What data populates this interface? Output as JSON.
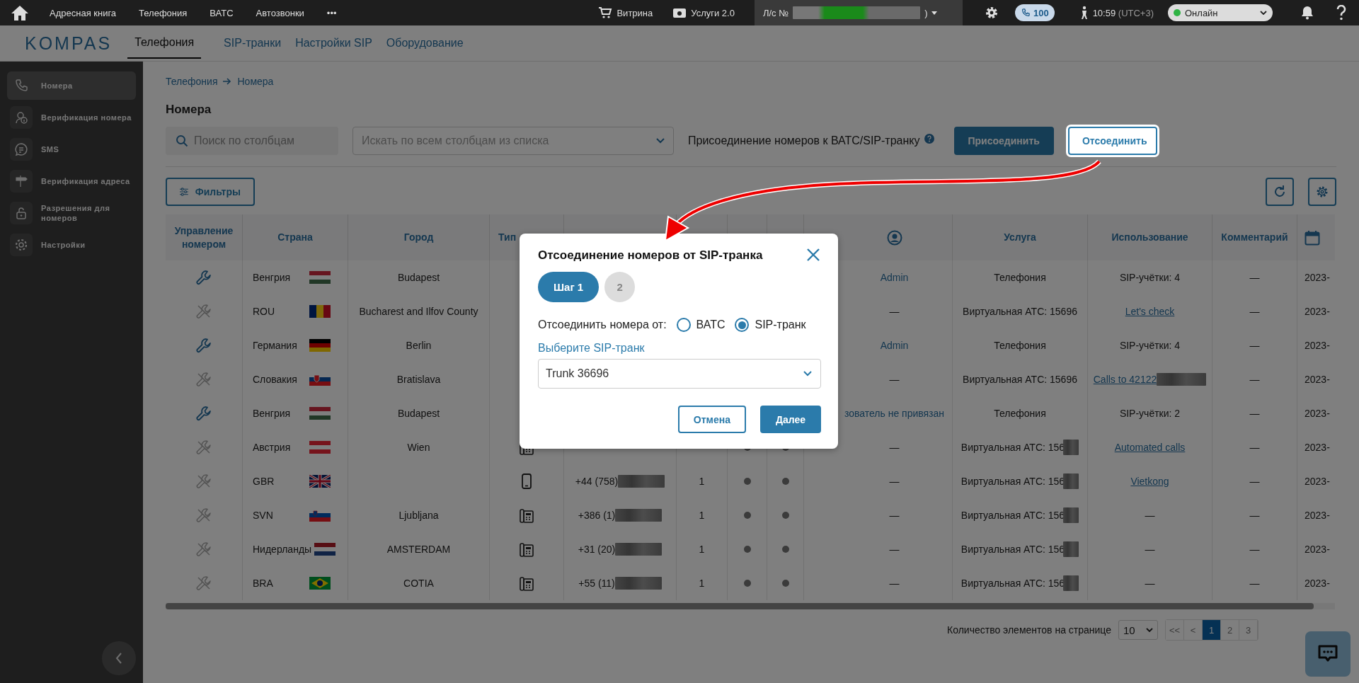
{
  "topbar": {
    "nav": [
      "Адресная книга",
      "Телефония",
      "ВАТС",
      "Автозвонки",
      "•••"
    ],
    "showcase": "Витрина",
    "services": "Услуги 2.0",
    "account_prefix": "Л/с №",
    "account_suffix": ")",
    "calls_badge": "100",
    "time": "10:59",
    "timezone": "(UTC+3)",
    "status": {
      "label": "Онлайн",
      "color": "#2fb344"
    }
  },
  "subnav": {
    "logo": "KOMPAS",
    "tabs": [
      {
        "label": "Телефония",
        "selected": true
      },
      {
        "label": "SIP-транки",
        "selected": false
      },
      {
        "label": "Настройки SIP",
        "selected": false
      },
      {
        "label": "Оборудование",
        "selected": false
      }
    ]
  },
  "sidebar": {
    "items": [
      {
        "label": "Номера",
        "kind": "phone",
        "selected": true
      },
      {
        "label": "Верификация номера",
        "kind": "verify",
        "selected": false
      },
      {
        "label": "SMS",
        "kind": "sms",
        "selected": false
      },
      {
        "label": "Верификация адреса",
        "kind": "sign",
        "selected": false
      },
      {
        "label": "Разрешения для номеров",
        "kind": "lock",
        "selected": false
      },
      {
        "label": "Настройки",
        "kind": "gear",
        "selected": false
      }
    ]
  },
  "breadcrumb": [
    "Телефония",
    "Номера"
  ],
  "title": "Номера",
  "toolbar": {
    "search_placeholder": "Поиск по столбцам",
    "columns_placeholder": "Искать по всем столбцам из списка",
    "attach_label": "Присоединение номеров к ВАТС/SIP-транку",
    "attach_button": "Присоединить",
    "detach_button": "Отсоединить",
    "filters_button": "Фильтры"
  },
  "table": {
    "headers": {
      "manage": "Управление номером",
      "country": "Страна",
      "city": "Город",
      "type": "Тип",
      "service": "Услуга",
      "usage": "Использование",
      "comment": "Комментарий"
    },
    "rows": [
      {
        "manage_enabled": true,
        "country": "Венгрия",
        "flag": {
          "kind": "hu"
        },
        "city": "Budapest",
        "user": "Admin",
        "user_link": true,
        "service": "Телефония",
        "usage": "SIP-учётки: 4",
        "usage_link": false,
        "comment": "—",
        "date": "2023-"
      },
      {
        "manage_enabled": false,
        "country": "ROU",
        "flag": {
          "kind": "ro"
        },
        "city": "Bucharest and Ilfov County",
        "user": "—",
        "user_link": false,
        "service": "Виртуальная АТС: 15696",
        "usage": "Let's check",
        "usage_link": true,
        "comment": "—",
        "date": "2023-"
      },
      {
        "manage_enabled": true,
        "country": "Германия",
        "flag": {
          "kind": "de"
        },
        "city": "Berlin",
        "user": "Admin",
        "user_link": true,
        "service": "Телефония",
        "usage": "SIP-учётки: 4",
        "usage_link": false,
        "comment": "—",
        "date": "2023-"
      },
      {
        "manage_enabled": false,
        "country": "Словакия",
        "flag": {
          "kind": "sk"
        },
        "city": "Bratislava",
        "user": "—",
        "user_link": false,
        "service": "Виртуальная АТС: 15696",
        "usage": "Calls to 42122",
        "usage_link": true,
        "usage_redacted": true,
        "comment": "—",
        "date": "2023-"
      },
      {
        "manage_enabled": true,
        "country": "Венгрия",
        "flag": {
          "kind": "hu"
        },
        "city": "Budapest",
        "user": "зователь не привязан",
        "user_link": true,
        "service": "Телефония",
        "usage": "SIP-учётки: 2",
        "usage_link": false,
        "comment": "—",
        "date": "2023-"
      },
      {
        "manage_enabled": false,
        "country": "Австрия",
        "flag": {
          "kind": "at"
        },
        "city": "Wien",
        "phone": {
          "kind": "desk"
        },
        "status_dots": true,
        "user": "—",
        "user_link": false,
        "service": "Виртуальная АТС: 156",
        "service_redacted": true,
        "usage": "Automated calls",
        "usage_link": true,
        "comment": "—",
        "date": "2023-"
      },
      {
        "manage_enabled": false,
        "country": "GBR",
        "flag": {
          "kind": "gb"
        },
        "phone": {
          "kind": "mobile",
          "number": "+44 (758)"
        },
        "count": "1",
        "status_dots": true,
        "user": "—",
        "user_link": false,
        "service": "Виртуальная АТС: 156",
        "service_redacted": true,
        "usage": "Vietkong",
        "usage_link": true,
        "comment": "—",
        "date": "2023-"
      },
      {
        "manage_enabled": false,
        "country": "SVN",
        "flag": {
          "kind": "si"
        },
        "city": "Ljubljana",
        "phone": {
          "kind": "desk",
          "number": "+386 (1)"
        },
        "count": "1",
        "status_dots": true,
        "user": "—",
        "user_link": false,
        "service": "Виртуальная АТС: 156",
        "service_redacted": true,
        "usage": "—",
        "usage_link": false,
        "comment": "—",
        "date": "2023-"
      },
      {
        "manage_enabled": false,
        "country": "Нидерланды",
        "flag": {
          "kind": "nl"
        },
        "city": "AMSTERDAM",
        "phone": {
          "kind": "desk",
          "number": "+31 (20)"
        },
        "count": "1",
        "status_dots": true,
        "user": "—",
        "user_link": false,
        "service": "Виртуальная АТС: 156",
        "service_redacted": true,
        "usage": "—",
        "usage_link": false,
        "comment": "—",
        "date": "2023-"
      },
      {
        "manage_enabled": false,
        "country": "BRA",
        "flag": {
          "kind": "br"
        },
        "city": "COTIA",
        "phone": {
          "kind": "desk",
          "number": "+55 (11)"
        },
        "count": "1",
        "status_dots": true,
        "user": "—",
        "user_link": false,
        "service": "Виртуальная АТС: 156",
        "service_redacted": true,
        "usage": "—",
        "usage_link": false,
        "comment": "—",
        "date": "2023-"
      }
    ]
  },
  "pagination": {
    "per_page_label": "Количество элементов на странице",
    "per_page": "10",
    "pages": [
      {
        "label": "<<",
        "selected": false
      },
      {
        "label": "<",
        "selected": false
      },
      {
        "label": "1",
        "selected": true
      },
      {
        "label": "2",
        "selected": false
      },
      {
        "label": "3",
        "selected": false
      }
    ]
  },
  "modal": {
    "title": "Отсоединение номеров от SIP-транка",
    "steps": [
      {
        "label": "Шаг 1",
        "selected": true
      },
      {
        "label": "2",
        "selected": false
      }
    ],
    "detach_from_label": "Отсоединить номера от:",
    "options": [
      {
        "label": "ВАТС",
        "selected": false
      },
      {
        "label": "SIP-транк",
        "selected": true
      }
    ],
    "trunk_label": "Выберите SIP-транк",
    "trunk_value": "Trunk 36696",
    "cancel": "Отмена",
    "next": "Далее"
  }
}
